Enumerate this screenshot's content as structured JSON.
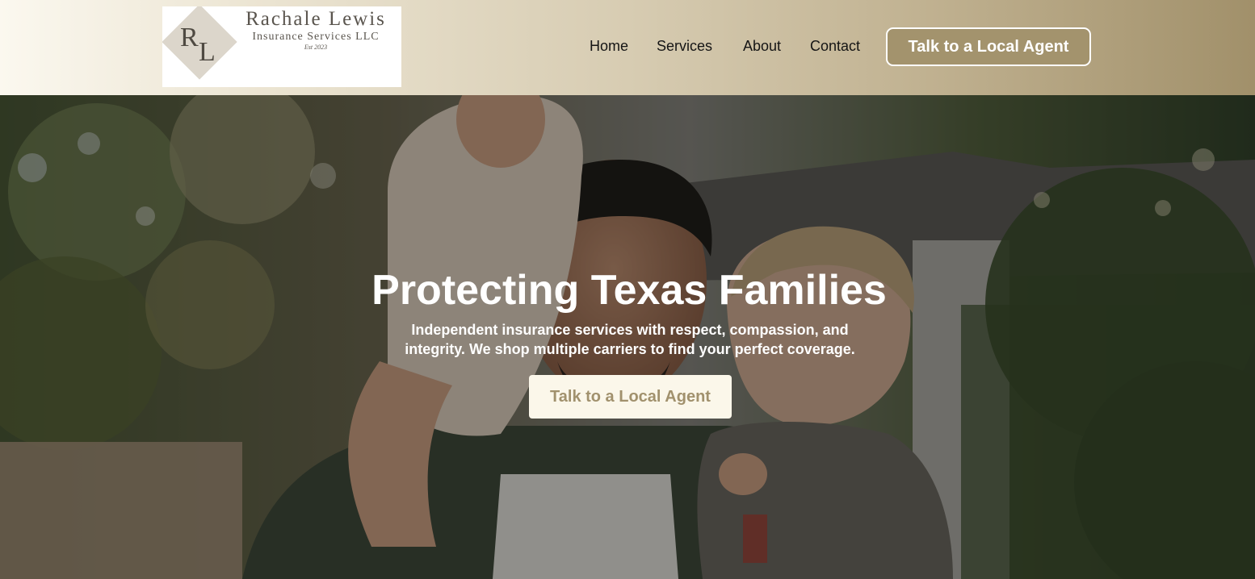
{
  "header": {
    "logo": {
      "monogram": "RL",
      "name": "Rachale Lewis",
      "subtitle": "Insurance Services LLC",
      "established": "Est 2023"
    },
    "nav": [
      {
        "label": "Home"
      },
      {
        "label": "Services"
      },
      {
        "label": "About"
      },
      {
        "label": "Contact"
      }
    ],
    "cta_label": "Talk to a Local Agent"
  },
  "hero": {
    "title": "Protecting Texas Families",
    "subtitle": "Independent insurance services with respect, compassion, and integrity. We shop multiple carriers to find your perfect coverage.",
    "cta_label": "Talk to a Local Agent"
  },
  "colors": {
    "accent": "#a3936d",
    "header_light": "#fbf8ef",
    "header_dark": "#a1906a",
    "cta_bg": "#fbf7ea",
    "cta_text": "#a1916d"
  }
}
